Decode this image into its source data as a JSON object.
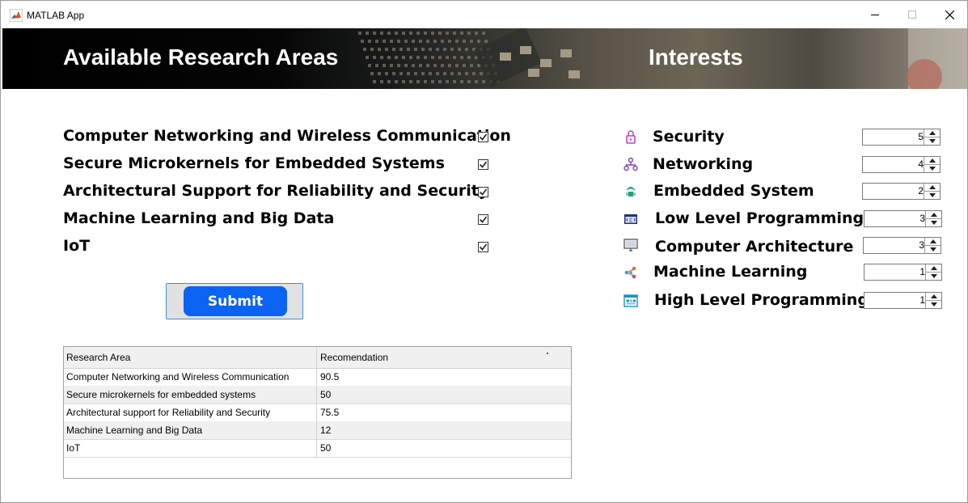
{
  "window": {
    "title": "MATLAB App"
  },
  "banner": {
    "left_title": "Available Research Areas",
    "right_title": "Interests"
  },
  "research_areas": [
    {
      "label": "Computer Networking and Wireless Communication",
      "checked": true
    },
    {
      "label": "Secure Microkernels for Embedded Systems",
      "checked": true
    },
    {
      "label": "Architectural Support for Reliability and Security",
      "checked": true
    },
    {
      "label": "Machine Learning and Big Data",
      "checked": true
    },
    {
      "label": "IoT",
      "checked": true
    }
  ],
  "submit": {
    "label": "Submit"
  },
  "table": {
    "headers": [
      "Research Area",
      "Recomendation"
    ],
    "rows": [
      [
        "Computer Networking and Wireless Communication",
        "90.5"
      ],
      [
        "Secure microkernels for embedded systems",
        "50"
      ],
      [
        "Architectural support for Reliability and Security",
        "75.5"
      ],
      [
        "Machine Learning and Big Data",
        "12"
      ],
      [
        "IoT",
        "50"
      ]
    ]
  },
  "interests": [
    {
      "label": "Security",
      "value": "5",
      "icon": "lock-icon",
      "color": "#c040c0"
    },
    {
      "label": "Networking",
      "value": "4",
      "icon": "network-icon",
      "color": "#8040c0"
    },
    {
      "label": "Embedded System",
      "value": "2",
      "icon": "wireless-chip-icon",
      "color": "#20a080"
    },
    {
      "label": "Low Level Programming",
      "value": "3",
      "icon": "code-window-icon",
      "color": "#203080"
    },
    {
      "label": "Computer Architecture",
      "value": "3",
      "icon": "monitor-icon",
      "color": "#606060"
    },
    {
      "label": "Machine Learning",
      "value": "1",
      "icon": "ml-nodes-icon",
      "color": "#e07020"
    },
    {
      "label": "High Level Programming",
      "value": "1",
      "icon": "code-blocks-icon",
      "color": "#2090c0"
    }
  ],
  "colors": {
    "submit_bg": "#0b63f3",
    "submit_frame": "#3b8fd6"
  }
}
